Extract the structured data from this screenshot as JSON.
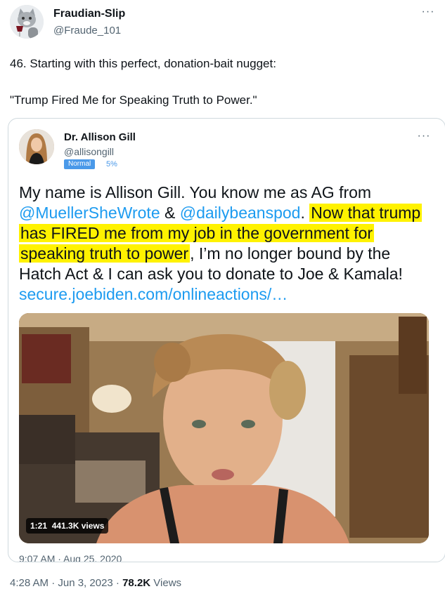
{
  "author": {
    "display_name": "Fraudian-Slip",
    "handle": "@Fraude_101",
    "avatar_icon": "cat-with-wine-avatar"
  },
  "tweet": {
    "text_line1": "46. Starting with this perfect, donation-bait nugget:",
    "text_line2": "\"Trump Fired Me for Speaking Truth to Power.\""
  },
  "embedded": {
    "author_name": "Dr. Allison Gill",
    "author_handle": "@allisongill",
    "badge_label": "Normal",
    "badge_percent": "5%",
    "lines": {
      "l1": "My name is Allison Gill. You know me as AG from",
      "l2_mention1": "@MuellerSheWrote",
      "l2_amp": " & ",
      "l2_mention2": "@dailybeanspod",
      "l2_dot": ".",
      "l2_hl": "Now that trump",
      "l3_hl": "has FIRED me from my job in the government for",
      "l4_hl": "speaking truth to power",
      "l4_rest": ", I’m no longer bound by the",
      "l5": "Hatch Act & I can ask you to donate to Joe & Kamala!",
      "l6_link": "secure.joebiden.com/onlineactions/…"
    },
    "video": {
      "duration": "1:21",
      "views": "441.3K views"
    },
    "timestamp_cut": "9:07 AM · Aug 25, 2020"
  },
  "footer": {
    "time": "4:28 AM · Jun 3, 2023 · ",
    "view_count": "78.2K",
    "views_label": " Views"
  },
  "colors": {
    "link": "#1d9bf0",
    "highlight": "#fff200",
    "secondary_text": "#536471",
    "badge": "#4a99e9"
  }
}
